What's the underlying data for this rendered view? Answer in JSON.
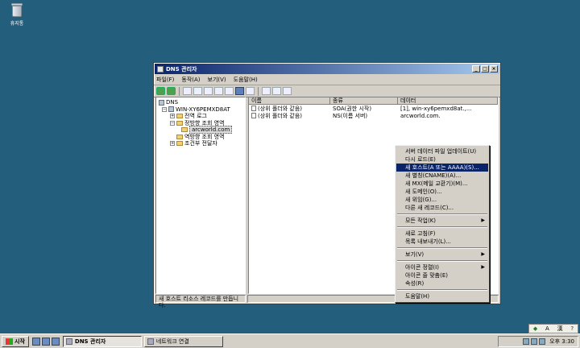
{
  "desktop": {
    "recycle_bin_label": "휴지통"
  },
  "window": {
    "title": "DNS 관리자",
    "buttons": {
      "minimize": "_",
      "maximize": "□",
      "close": "×"
    },
    "menu": [
      "파일(F)",
      "동작(A)",
      "보기(V)",
      "도움말(H)"
    ],
    "tree": {
      "root": "DNS",
      "server": "WIN-XY6PEMXD8AT",
      "global_logs": "전역 로그",
      "forward_zones": "정방향 조회 영역",
      "zone": "arcworld.com",
      "reverse_zones": "역방향 조회 영역",
      "conditional_forwarders": "조건부 전달자"
    },
    "columns": [
      "이름",
      "종류",
      "데이터"
    ],
    "records": [
      {
        "name": "(상위 폴더와 같음)",
        "type": "SOA(권한 시작)",
        "data": "[1], win-xy6pemxd8at.,..."
      },
      {
        "name": "(상위 폴더와 같음)",
        "type": "NS(이름 서버)",
        "data": "arcworld.com."
      }
    ],
    "status_text": "새 호스트 리소스 레코드를 만듭니다."
  },
  "context_menu": {
    "items": [
      "서버 데이터 파일 업데이트(U)",
      "다시 로드(E)",
      "새 호스트(A 또는 AAAA)(S)...",
      "새 별칭(CNAME)(A)...",
      "새 MX(메일 교환기)(M)...",
      "새 도메인(O)...",
      "새 위임(G)...",
      "다른 새 레코드(C)...",
      "모든 작업(K)",
      "새로 고침(F)",
      "목록 내보내기(L)...",
      "보기(V)",
      "아이콘 정렬(I)",
      "아이콘 줄 맞춤(E)",
      "속성(R)",
      "도움말(H)"
    ],
    "highlighted_index": 2,
    "submenu_arrow": "▶"
  },
  "taskbar": {
    "start_label": "시작",
    "tasks": [
      "DNS 관리자",
      "네트워크 연결"
    ],
    "clock": "오후 3:30"
  },
  "language_bar": {
    "mode1": "A",
    "mode2": "漢"
  }
}
